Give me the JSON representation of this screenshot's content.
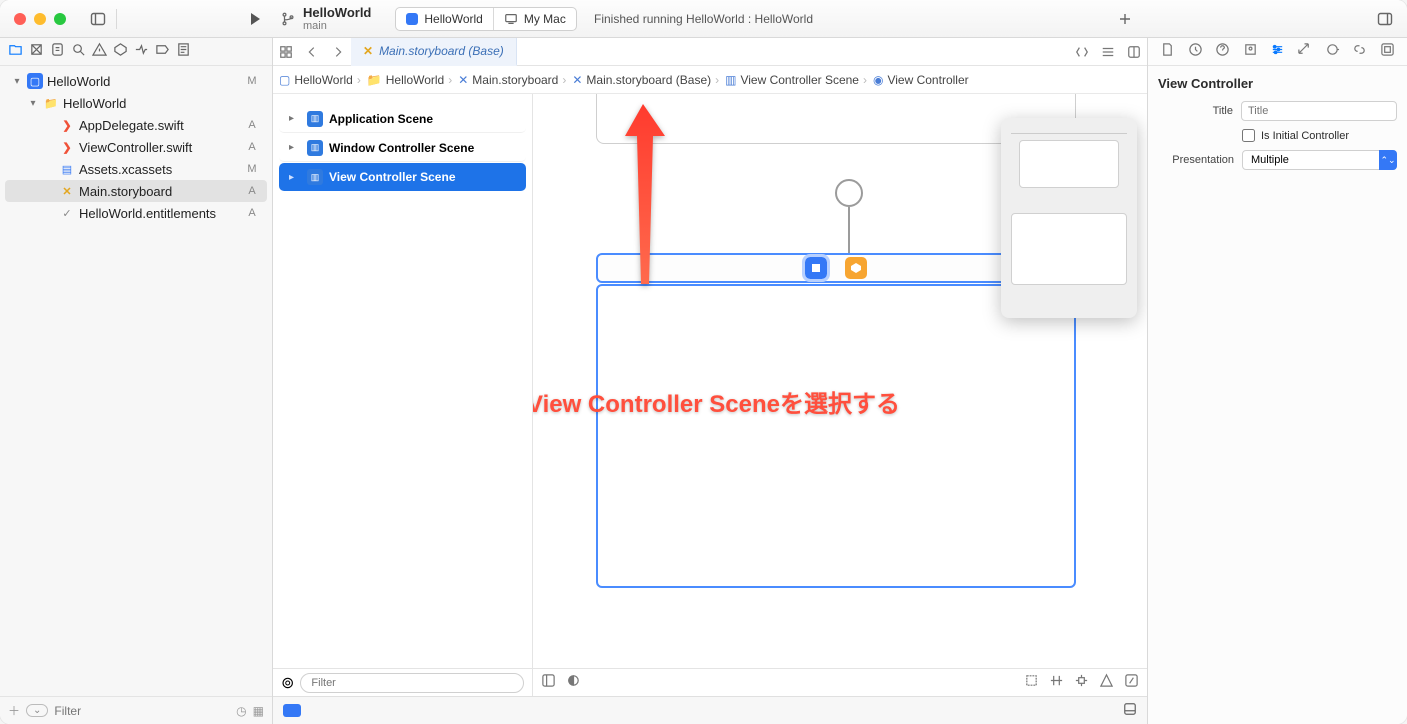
{
  "project": {
    "name": "HelloWorld",
    "branch": "main"
  },
  "scheme": {
    "target": "HelloWorld",
    "device": "My Mac"
  },
  "status": "Finished running HelloWorld : HelloWorld",
  "editor": {
    "tab_label": "Main.storyboard (Base)"
  },
  "breadcrumbs": [
    "HelloWorld",
    "HelloWorld",
    "Main.storyboard",
    "Main.storyboard (Base)",
    "View Controller Scene",
    "View Controller"
  ],
  "nav": {
    "items": [
      {
        "label": "HelloWorld",
        "badge": "M",
        "indent": 0,
        "type": "app",
        "disc": "▾"
      },
      {
        "label": "HelloWorld",
        "badge": "",
        "indent": 1,
        "type": "folder",
        "disc": "▾"
      },
      {
        "label": "AppDelegate.swift",
        "badge": "A",
        "indent": 2,
        "type": "swift",
        "disc": ""
      },
      {
        "label": "ViewController.swift",
        "badge": "A",
        "indent": 2,
        "type": "swift",
        "disc": ""
      },
      {
        "label": "Assets.xcassets",
        "badge": "M",
        "indent": 2,
        "type": "assets",
        "disc": ""
      },
      {
        "label": "Main.storyboard",
        "badge": "A",
        "indent": 2,
        "type": "sb",
        "disc": "",
        "selected": true
      },
      {
        "label": "HelloWorld.entitlements",
        "badge": "A",
        "indent": 2,
        "type": "ent",
        "disc": ""
      }
    ],
    "filter_placeholder": "Filter"
  },
  "outline": {
    "items": [
      {
        "label": "Application Scene",
        "type": "app"
      },
      {
        "label": "Window Controller Scene",
        "type": "win"
      },
      {
        "label": "View Controller Scene",
        "type": "vc",
        "selected": true
      }
    ],
    "filter_placeholder": "Filter"
  },
  "inspector": {
    "heading": "View Controller",
    "title_label": "Title",
    "title_placeholder": "Title",
    "initial_label": "Is Initial Controller",
    "presentation_label": "Presentation",
    "presentation_value": "Multiple"
  },
  "annotation": "「View Controller Sceneを選択する"
}
